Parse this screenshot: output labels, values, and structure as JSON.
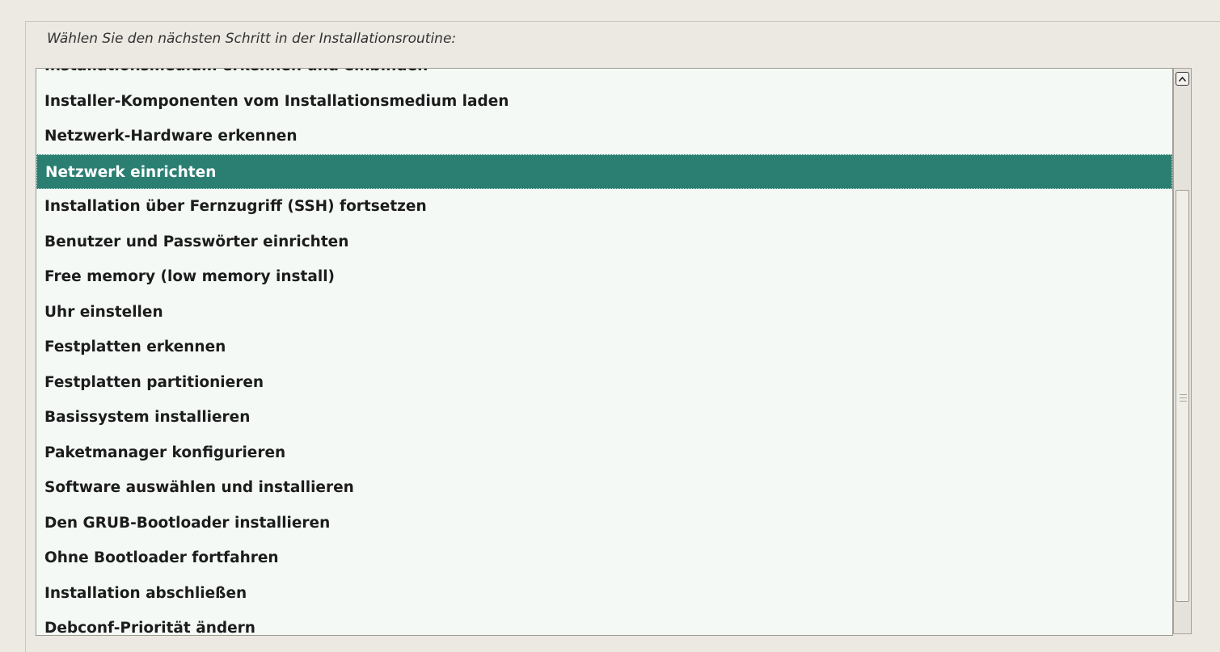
{
  "prompt": "Wählen Sie den nächsten Schritt in der Installationsroutine:",
  "items": [
    {
      "label": "Installationsmedium erkennen und einbinden",
      "selected": false
    },
    {
      "label": "Installer-Komponenten vom Installationsmedium laden",
      "selected": false
    },
    {
      "label": "Netzwerk-Hardware erkennen",
      "selected": false
    },
    {
      "label": "Netzwerk einrichten",
      "selected": true
    },
    {
      "label": "Installation über Fernzugriff (SSH) fortsetzen",
      "selected": false
    },
    {
      "label": "Benutzer und Passwörter einrichten",
      "selected": false
    },
    {
      "label": "Free memory (low memory install)",
      "selected": false
    },
    {
      "label": "Uhr einstellen",
      "selected": false
    },
    {
      "label": "Festplatten erkennen",
      "selected": false
    },
    {
      "label": "Festplatten partitionieren",
      "selected": false
    },
    {
      "label": "Basissystem installieren",
      "selected": false
    },
    {
      "label": "Paketmanager konfigurieren",
      "selected": false
    },
    {
      "label": "Software auswählen und installieren",
      "selected": false
    },
    {
      "label": "Den GRUB-Bootloader installieren",
      "selected": false
    },
    {
      "label": "Ohne Bootloader fortfahren",
      "selected": false
    },
    {
      "label": "Installation abschließen",
      "selected": false
    },
    {
      "label": "Debconf-Priorität ändern",
      "selected": false
    }
  ],
  "scrollbar": {
    "up_icon": "chevron-up-icon",
    "grip_icon": "grip-icon"
  },
  "colors": {
    "selection": "#2a7f72",
    "list_background": "#f4f9f5",
    "window_background": "#eceae3"
  }
}
